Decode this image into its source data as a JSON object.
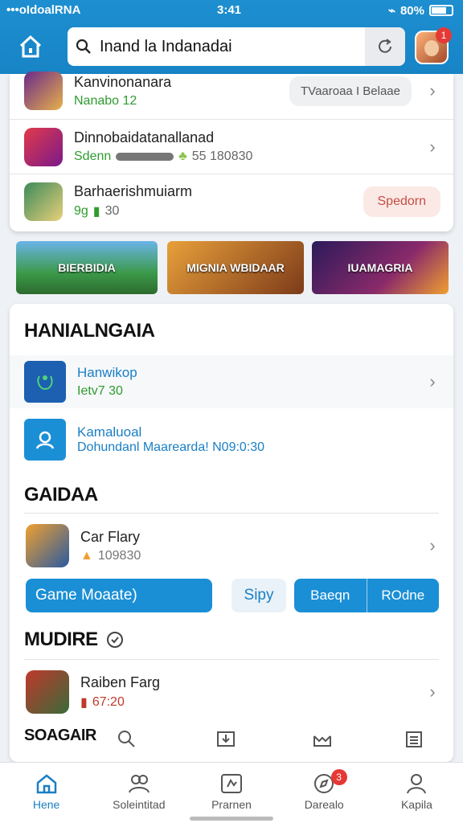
{
  "status_bar": {
    "carrier": "•••oIdoalRNA",
    "time": "3:41",
    "battery": "80%"
  },
  "search": {
    "value": "Inand la Indanadai"
  },
  "avatar_badge": "1",
  "top_list": [
    {
      "title": "Kanvinonanara",
      "sub": "Nanabo 12",
      "action": "TVaaroaa I Belaae"
    },
    {
      "title": "Dinnobaidatanallanad",
      "sub": "Sdenn",
      "meta": "55 180830"
    },
    {
      "title": "Barhaerishmuiarm",
      "sub": "9g",
      "meta": "30",
      "action": "Spedorn"
    }
  ],
  "banners": [
    "BIERBIDIA",
    "MIGNIA WBIDAAR",
    "IUAMAGRIA"
  ],
  "section1": {
    "title": "HANIALNGAIA",
    "items": [
      {
        "title": "Hanwikop",
        "sub": "Ietv7 30"
      },
      {
        "title": "Kamaluoal",
        "sub": "Dohundanl Maarearda! N09:0:30"
      }
    ]
  },
  "section2": {
    "title": "GAIDAA",
    "item": {
      "title": "Car Flary",
      "sub": "109830"
    }
  },
  "buttons": {
    "main": "Game Moaate)",
    "light": "Sipy",
    "seg1": "Baeqn",
    "seg2": "ROdne"
  },
  "section3": {
    "title": "MUDIRE",
    "item": {
      "title": "Raiben Farg",
      "sub": "67:20"
    }
  },
  "section4": {
    "title": "SOAGAIR"
  },
  "nav": [
    {
      "label": "Hene",
      "icon": "home-icon"
    },
    {
      "label": "Soleintitad",
      "icon": "users-icon"
    },
    {
      "label": "Prarnen",
      "icon": "media-icon"
    },
    {
      "label": "Darealo",
      "icon": "compass-icon",
      "badge": "3"
    },
    {
      "label": "Kapila",
      "icon": "profile-icon"
    }
  ],
  "colors": {
    "accent": "#1a8fd6",
    "header": "#1784c6",
    "badge": "#e53935",
    "green": "#2e9c2e"
  }
}
